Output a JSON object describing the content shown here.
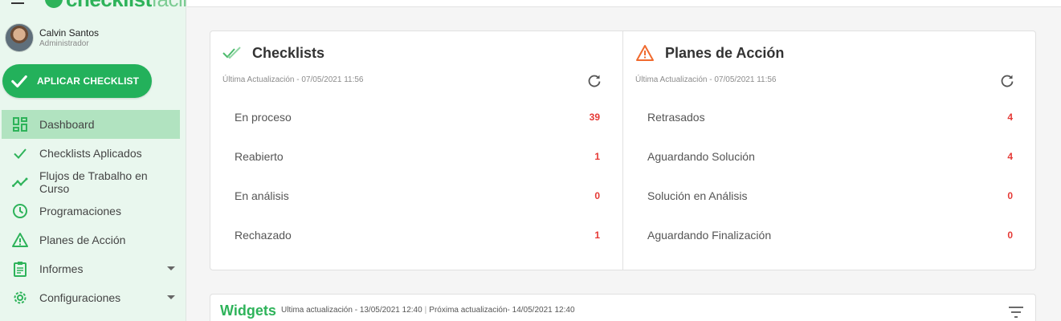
{
  "brand": {
    "name_bold": "checklist",
    "name_light": "fácil"
  },
  "user": {
    "name": "Calvin Santos",
    "role": "Administrador"
  },
  "apply_button": {
    "label": "APLICAR CHECKLIST"
  },
  "nav": {
    "items": [
      {
        "label": "Dashboard",
        "icon": "dashboard-icon",
        "active": true
      },
      {
        "label": "Checklists Aplicados",
        "icon": "check-icon"
      },
      {
        "label": "Flujos de Trabalho en Curso",
        "icon": "trending-icon"
      },
      {
        "label": "Programaciones",
        "icon": "clock-icon"
      },
      {
        "label": "Planes de Acción",
        "icon": "warning-icon"
      },
      {
        "label": "Informes",
        "icon": "clipboard-icon"
      },
      {
        "label": "Configuraciones",
        "icon": "gear-icon"
      }
    ]
  },
  "checklists": {
    "title": "Checklists",
    "updated": "Última Actualización - 07/05/2021 11:56",
    "rows": [
      {
        "name": "En proceso",
        "value": "39"
      },
      {
        "name": "Reabierto",
        "value": "1"
      },
      {
        "name": "En análisis",
        "value": "0"
      },
      {
        "name": "Rechazado",
        "value": "1"
      }
    ]
  },
  "planes": {
    "title": "Planes de Acción",
    "updated": "Última Actualización - 07/05/2021 11:56",
    "rows": [
      {
        "name": "Retrasados",
        "value": "4"
      },
      {
        "name": "Aguardando Solución",
        "value": "4"
      },
      {
        "name": "Solución en Análisis",
        "value": "0"
      },
      {
        "name": "Aguardando Finalización",
        "value": "0"
      }
    ]
  },
  "widgets": {
    "title": "Widgets",
    "last_update": "Ultima actualización - 13/05/2021 12:40",
    "separator": "|",
    "next_update": "Próxima actualización- 14/05/2021 12:40"
  },
  "colors": {
    "accent": "#2eb35a",
    "danger": "#e53935",
    "sidebar_bg": "#e9f7ee",
    "active_bg": "#b1e3c0"
  }
}
